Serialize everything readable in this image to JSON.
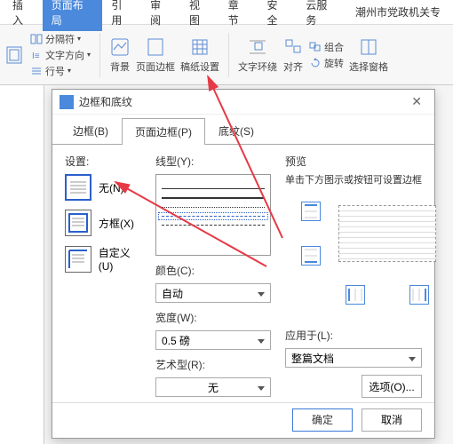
{
  "menubar": {
    "items": [
      "插入",
      "页面布局",
      "引用",
      "审阅",
      "视图",
      "章节",
      "安全",
      "云服务"
    ],
    "active": 1,
    "extra": "潮州市党政机关专"
  },
  "ribbon": {
    "small": [
      {
        "label": "分隔符",
        "icon": "split"
      },
      {
        "label": "文字方向",
        "icon": "textdir"
      },
      {
        "label": "行号",
        "icon": "lineno"
      }
    ],
    "big": [
      {
        "label": "背景",
        "icon": "bg"
      },
      {
        "label": "页面边框",
        "icon": "pageborder"
      },
      {
        "label": "稿纸设置",
        "icon": "manu"
      },
      {
        "label": "文字环绕",
        "icon": "wrap"
      },
      {
        "label": "对齐",
        "icon": "align"
      },
      {
        "label": "旋转",
        "icon": "rotate"
      },
      {
        "label": "选择窗格",
        "icon": "selpane"
      }
    ],
    "combo": {
      "label": "组合"
    }
  },
  "dialog": {
    "title": "边框和底纹",
    "tabs": [
      "边框(B)",
      "页面边框(P)",
      "底纹(S)"
    ],
    "activeTab": 1,
    "settings": {
      "label": "设置:",
      "options": [
        {
          "label": "无(N)"
        },
        {
          "label": "方框(X)"
        },
        {
          "label": "自定义(U)"
        }
      ]
    },
    "linestyle": {
      "label": "线型(Y):"
    },
    "color": {
      "label": "颜色(C):",
      "value": "自动"
    },
    "width": {
      "label": "宽度(W):",
      "value": "0.5  磅"
    },
    "art": {
      "label": "艺术型(R):",
      "value": "无"
    },
    "preview": {
      "label": "预览",
      "desc": "单击下方图示或按钮可设置边框"
    },
    "applyto": {
      "label": "应用于(L):",
      "value": "整篇文档"
    },
    "optionsBtn": "选项(O)...",
    "ok": "确定",
    "cancel": "取消"
  }
}
